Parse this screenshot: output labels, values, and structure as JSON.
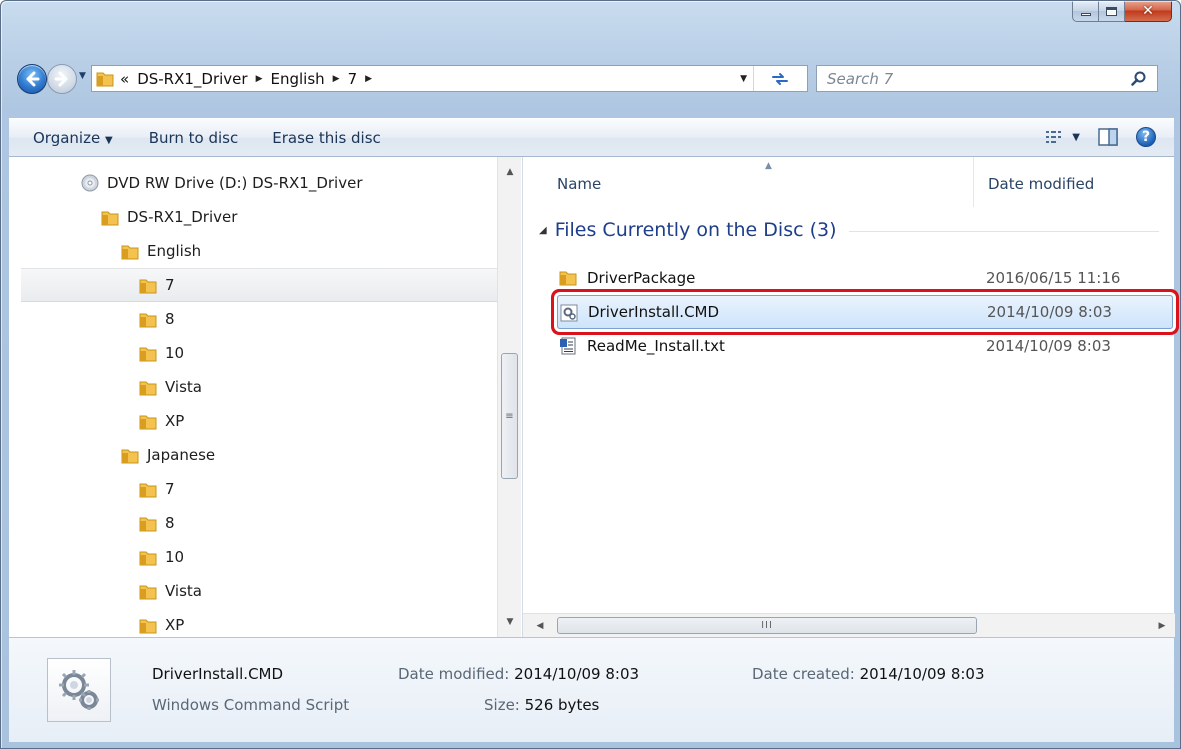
{
  "address": {
    "overflow": "«",
    "crumbs": [
      "DS-RX1_Driver",
      "English",
      "7"
    ]
  },
  "search": {
    "placeholder": "Search 7"
  },
  "toolbar": {
    "organize_label": "Organize",
    "burn_label": "Burn to disc",
    "erase_label": "Erase this disc"
  },
  "nav_tree": {
    "items": [
      {
        "label": "DVD RW Drive (D:) DS-RX1_Driver",
        "icon": "disc-icon",
        "selected": false
      },
      {
        "label": "DS-RX1_Driver",
        "icon": "folder-icon",
        "selected": false
      },
      {
        "label": "English",
        "icon": "folder-icon",
        "selected": false
      },
      {
        "label": "7",
        "icon": "folder-icon",
        "selected": true
      },
      {
        "label": "8",
        "icon": "folder-icon",
        "selected": false
      },
      {
        "label": "10",
        "icon": "folder-icon",
        "selected": false
      },
      {
        "label": "Vista",
        "icon": "folder-icon",
        "selected": false
      },
      {
        "label": "XP",
        "icon": "folder-icon",
        "selected": false
      },
      {
        "label": "Japanese",
        "icon": "folder-icon",
        "selected": false
      },
      {
        "label": "7",
        "icon": "folder-icon",
        "selected": false
      },
      {
        "label": "8",
        "icon": "folder-icon",
        "selected": false
      },
      {
        "label": "10",
        "icon": "folder-icon",
        "selected": false
      },
      {
        "label": "Vista",
        "icon": "folder-icon",
        "selected": false
      },
      {
        "label": "XP",
        "icon": "folder-icon",
        "selected": false
      }
    ]
  },
  "file_list": {
    "columns": {
      "name": "Name",
      "date": "Date modified"
    },
    "group_label": "Files Currently on the Disc (3)",
    "files": [
      {
        "name": "DriverPackage",
        "date": "2016/06/15 11:16",
        "icon": "folder-icon",
        "selected": false
      },
      {
        "name": "DriverInstall.CMD",
        "date": "2014/10/09 8:03",
        "icon": "cmd-script-icon",
        "selected": true
      },
      {
        "name": "ReadMe_Install.txt",
        "date": "2014/10/09 8:03",
        "icon": "text-file-icon",
        "selected": false
      }
    ]
  },
  "details": {
    "name": "DriverInstall.CMD",
    "type": "Windows Command Script",
    "modified_label": "Date modified:",
    "modified_value": "2014/10/09 8:03",
    "size_label": "Size:",
    "size_value": "526 bytes",
    "created_label": "Date created:",
    "created_value": "2014/10/09 8:03"
  },
  "colors": {
    "highlight_outline": "#d9121b",
    "selection_fill": "#cde4fb",
    "group_text": "#1e3e8a"
  }
}
